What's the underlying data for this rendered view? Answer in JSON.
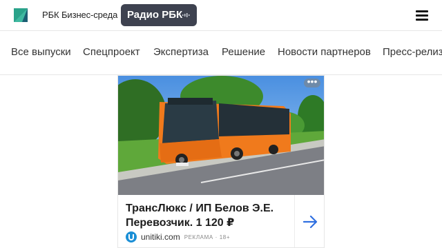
{
  "header": {
    "brand": "РБК Бизнес-среда",
    "radio_label": "Радио РБК"
  },
  "nav": {
    "items": [
      "Все выпуски",
      "Спецпроект",
      "Экспертиза",
      "Решение",
      "Новости партнеров",
      "Пресс-релизы"
    ]
  },
  "ad": {
    "title": "ТрансЛюкс / ИП Белов Э.Е. Перевозчик. 1 120 ₽",
    "domain": "unitiki.com",
    "label": "РЕКЛАМА · 18+",
    "more": "•••"
  },
  "colors": {
    "radio_bg": "#3e4250",
    "arrow": "#2f6fe0",
    "bus": "#f07a1c"
  },
  "icons": {
    "logo": "rbc-logo-icon",
    "radio": "sound-wave-icon",
    "menu": "hamburger-menu-icon",
    "domain": "unitiki-icon",
    "arrow": "arrow-right-icon",
    "more": "more-options-icon"
  }
}
